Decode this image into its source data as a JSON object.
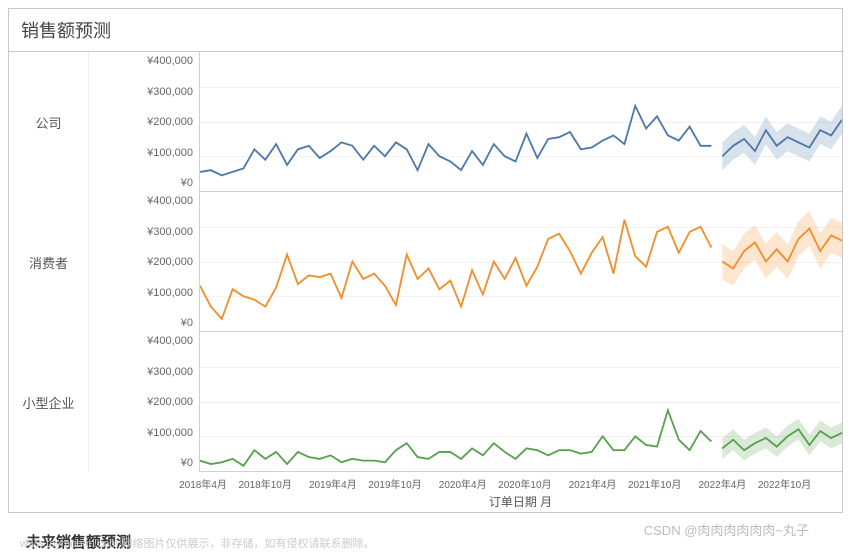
{
  "title": "销售额预测",
  "bottom_title": "未来销售额预测",
  "x_label": "订单日期 月",
  "x_ticks": [
    "2018年4月",
    "2018年10月",
    "2019年4月",
    "2019年10月",
    "2020年4月",
    "2020年10月",
    "2021年4月",
    "2021年10月",
    "2022年4月",
    "2022年10月"
  ],
  "y_ticks": [
    "¥400,000",
    "¥300,000",
    "¥200,000",
    "¥100,000",
    "¥0"
  ],
  "panels": [
    {
      "label": "公司",
      "color": "#4e79a7",
      "band": "rgba(78,121,167,0.22)"
    },
    {
      "label": "消费者",
      "color": "#f28e2b",
      "band": "rgba(242,142,43,0.22)"
    },
    {
      "label": "小型企业",
      "color": "#59a14f",
      "band": "rgba(89,161,79,0.22)"
    }
  ],
  "watermark1": "CSDN @肉肉肉肉肉肉~丸子",
  "watermark2": "www.toymoban.com 网络图片仅供展示，非存储，如有侵权请联系删除。",
  "chart_data": {
    "type": "line",
    "x_label": "订单日期 月",
    "ylim": [
      0,
      400000
    ],
    "y_format": "currency_cny",
    "x": [
      "2018-01",
      "2018-02",
      "2018-03",
      "2018-04",
      "2018-05",
      "2018-06",
      "2018-07",
      "2018-08",
      "2018-09",
      "2018-10",
      "2018-11",
      "2018-12",
      "2019-01",
      "2019-02",
      "2019-03",
      "2019-04",
      "2019-05",
      "2019-06",
      "2019-07",
      "2019-08",
      "2019-09",
      "2019-10",
      "2019-11",
      "2019-12",
      "2020-01",
      "2020-02",
      "2020-03",
      "2020-04",
      "2020-05",
      "2020-06",
      "2020-07",
      "2020-08",
      "2020-09",
      "2020-10",
      "2020-11",
      "2020-12",
      "2021-01",
      "2021-02",
      "2021-03",
      "2021-04",
      "2021-05",
      "2021-06",
      "2021-07",
      "2021-08",
      "2021-09",
      "2021-10",
      "2021-11",
      "2021-12"
    ],
    "x_forecast": [
      "2022-01",
      "2022-02",
      "2022-03",
      "2022-04",
      "2022-05",
      "2022-06",
      "2022-07",
      "2022-08",
      "2022-09",
      "2022-10",
      "2022-11",
      "2022-12"
    ],
    "series": [
      {
        "name": "公司",
        "values": [
          55000,
          60000,
          45000,
          55000,
          65000,
          120000,
          90000,
          135000,
          75000,
          120000,
          130000,
          95000,
          115000,
          140000,
          130000,
          90000,
          130000,
          100000,
          140000,
          120000,
          60000,
          135000,
          100000,
          85000,
          60000,
          115000,
          75000,
          135000,
          100000,
          85000,
          165000,
          95000,
          150000,
          155000,
          170000,
          120000,
          125000,
          145000,
          160000,
          135000,
          245000,
          180000,
          215000,
          160000,
          145000,
          185000,
          130000,
          130000
        ],
        "forecast": [
          100000,
          130000,
          150000,
          115000,
          175000,
          130000,
          155000,
          140000,
          125000,
          175000,
          160000,
          205000
        ],
        "forecast_low": [
          60000,
          90000,
          110000,
          75000,
          135000,
          90000,
          115000,
          100000,
          85000,
          135000,
          120000,
          165000
        ],
        "forecast_high": [
          140000,
          170000,
          190000,
          155000,
          215000,
          170000,
          195000,
          180000,
          165000,
          215000,
          200000,
          245000
        ]
      },
      {
        "name": "消费者",
        "values": [
          130000,
          70000,
          35000,
          120000,
          100000,
          90000,
          70000,
          125000,
          220000,
          135000,
          160000,
          155000,
          165000,
          95000,
          200000,
          150000,
          165000,
          130000,
          75000,
          220000,
          150000,
          180000,
          120000,
          145000,
          70000,
          175000,
          105000,
          200000,
          150000,
          210000,
          130000,
          185000,
          265000,
          280000,
          230000,
          165000,
          225000,
          270000,
          165000,
          320000,
          215000,
          185000,
          285000,
          300000,
          225000,
          285000,
          300000,
          240000
        ],
        "forecast": [
          200000,
          180000,
          230000,
          255000,
          200000,
          235000,
          200000,
          265000,
          295000,
          230000,
          275000,
          260000
        ],
        "forecast_low": [
          150000,
          130000,
          180000,
          205000,
          150000,
          185000,
          150000,
          215000,
          245000,
          180000,
          225000,
          210000
        ],
        "forecast_high": [
          250000,
          230000,
          280000,
          305000,
          250000,
          285000,
          250000,
          315000,
          345000,
          280000,
          325000,
          310000
        ]
      },
      {
        "name": "小型企业",
        "values": [
          30000,
          20000,
          25000,
          35000,
          15000,
          60000,
          35000,
          55000,
          20000,
          55000,
          40000,
          35000,
          45000,
          25000,
          35000,
          30000,
          30000,
          25000,
          60000,
          80000,
          40000,
          35000,
          55000,
          55000,
          35000,
          65000,
          45000,
          80000,
          55000,
          35000,
          65000,
          60000,
          45000,
          60000,
          60000,
          50000,
          55000,
          100000,
          60000,
          60000,
          100000,
          75000,
          70000,
          175000,
          90000,
          60000,
          115000,
          85000
        ],
        "forecast": [
          65000,
          90000,
          60000,
          80000,
          95000,
          70000,
          100000,
          120000,
          75000,
          115000,
          95000,
          110000
        ],
        "forecast_low": [
          35000,
          60000,
          30000,
          50000,
          65000,
          40000,
          70000,
          90000,
          45000,
          85000,
          65000,
          80000
        ],
        "forecast_high": [
          95000,
          120000,
          90000,
          110000,
          125000,
          100000,
          130000,
          150000,
          105000,
          145000,
          125000,
          140000
        ]
      }
    ]
  }
}
